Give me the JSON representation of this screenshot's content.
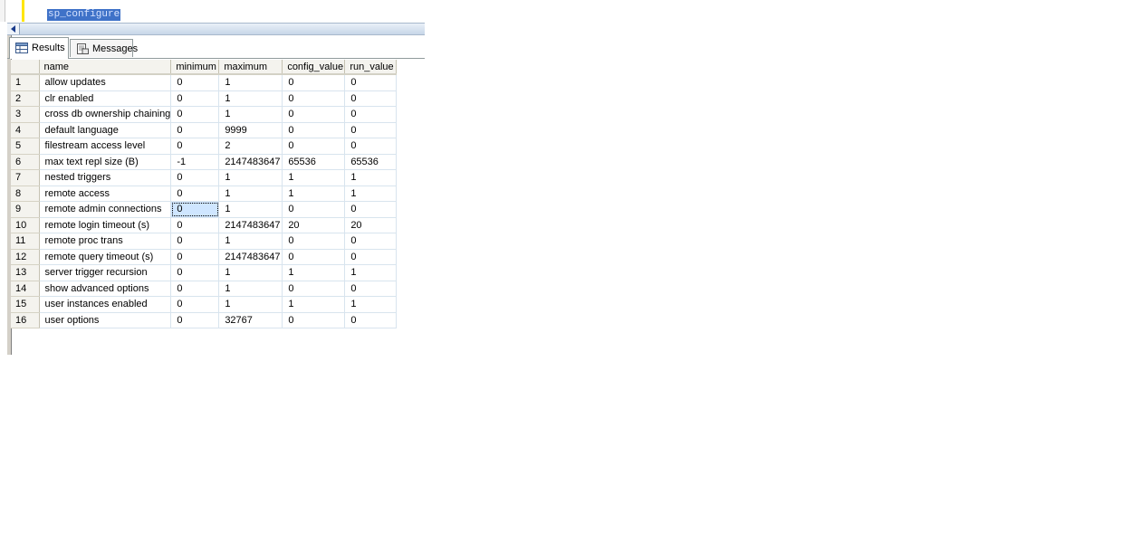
{
  "editor": {
    "query": "sp_configure"
  },
  "tabs": [
    {
      "label": "Results",
      "icon": "grid-icon",
      "active": true
    },
    {
      "label": "Messages",
      "icon": "messages-icon",
      "active": false
    }
  ],
  "grid": {
    "columns": [
      "name",
      "minimum",
      "maximum",
      "config_value",
      "run_value"
    ],
    "rows": [
      [
        "1",
        "allow updates",
        "0",
        "1",
        "0",
        "0"
      ],
      [
        "2",
        "clr enabled",
        "0",
        "1",
        "0",
        "0"
      ],
      [
        "3",
        "cross db ownership chaining",
        "0",
        "1",
        "0",
        "0"
      ],
      [
        "4",
        "default language",
        "0",
        "9999",
        "0",
        "0"
      ],
      [
        "5",
        "filestream access level",
        "0",
        "2",
        "0",
        "0"
      ],
      [
        "6",
        "max text repl size (B)",
        "-1",
        "2147483647",
        "65536",
        "65536"
      ],
      [
        "7",
        "nested triggers",
        "0",
        "1",
        "1",
        "1"
      ],
      [
        "8",
        "remote access",
        "0",
        "1",
        "1",
        "1"
      ],
      [
        "9",
        "remote admin connections",
        "0",
        "1",
        "0",
        "0"
      ],
      [
        "10",
        "remote login timeout (s)",
        "0",
        "2147483647",
        "20",
        "20"
      ],
      [
        "11",
        "remote proc trans",
        "0",
        "1",
        "0",
        "0"
      ],
      [
        "12",
        "remote query timeout (s)",
        "0",
        "2147483647",
        "0",
        "0"
      ],
      [
        "13",
        "server trigger recursion",
        "0",
        "1",
        "1",
        "1"
      ],
      [
        "14",
        "show advanced options",
        "0",
        "1",
        "0",
        "0"
      ],
      [
        "15",
        "user instances enabled",
        "0",
        "1",
        "1",
        "1"
      ],
      [
        "16",
        "user options",
        "0",
        "32767",
        "0",
        "0"
      ]
    ],
    "selected_cell": {
      "row": 9,
      "column": "minimum"
    }
  },
  "colors": {
    "selection_highlight": "#3f72c8",
    "current_line_marker": "#ffe600",
    "selected_cell_bg": "#cfe6ff"
  }
}
